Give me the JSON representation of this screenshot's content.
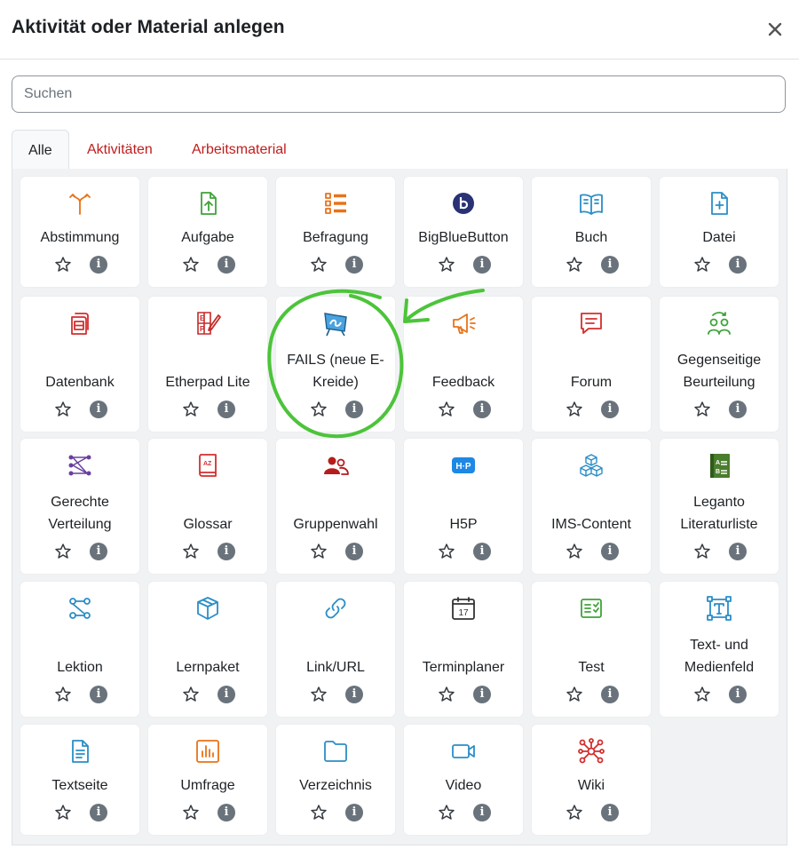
{
  "dialog": {
    "title": "Aktivität oder Material anlegen",
    "close_label": "×"
  },
  "search": {
    "placeholder": "Suchen"
  },
  "tabs": [
    {
      "label": "Alle",
      "active": true
    },
    {
      "label": "Aktivitäten",
      "active": false
    },
    {
      "label": "Arbeitsmaterial",
      "active": false
    }
  ],
  "info_glyph": "i",
  "modules": [
    {
      "name": "Abstimmung",
      "icon": "abstimmung-icon",
      "color": "#e8731a"
    },
    {
      "name": "Aufgabe",
      "icon": "aufgabe-icon",
      "color": "#3fa33a"
    },
    {
      "name": "Befragung",
      "icon": "befragung-icon",
      "color": "#e8731a"
    },
    {
      "name": "BigBlueButton",
      "icon": "bigbluebutton-icon",
      "color": "#283274"
    },
    {
      "name": "Buch",
      "icon": "buch-icon",
      "color": "#2a8ec7"
    },
    {
      "name": "Datei",
      "icon": "datei-icon",
      "color": "#2a8ec7"
    },
    {
      "name": "Datenbank",
      "icon": "datenbank-icon",
      "color": "#d32f2f"
    },
    {
      "name": "Etherpad Lite",
      "icon": "etherpad-icon",
      "color": "#c62828"
    },
    {
      "name": "FAILS (neue E-Kreide)",
      "icon": "fails-icon",
      "color": "#2a8ec7"
    },
    {
      "name": "Feedback",
      "icon": "feedback-icon",
      "color": "#e8731a"
    },
    {
      "name": "Forum",
      "icon": "forum-icon",
      "color": "#d32f2f"
    },
    {
      "name": "Gegenseitige Beurteilung",
      "icon": "gegenseitige-beurteilung-icon",
      "color": "#3fa33a"
    },
    {
      "name": "Gerechte Verteilung",
      "icon": "gerechte-verteilung-icon",
      "color": "#6a3fa0"
    },
    {
      "name": "Glossar",
      "icon": "glossar-icon",
      "color": "#d32f2f"
    },
    {
      "name": "Gruppenwahl",
      "icon": "gruppenwahl-icon",
      "color": "#b71c1c"
    },
    {
      "name": "H5P",
      "icon": "h5p-icon",
      "color": "#1e88e5"
    },
    {
      "name": "IMS-Content",
      "icon": "ims-content-icon",
      "color": "#2a8ec7"
    },
    {
      "name": "Leganto Literaturliste",
      "icon": "leganto-icon",
      "color": "#4a7d2c"
    },
    {
      "name": "Lektion",
      "icon": "lektion-icon",
      "color": "#2a8ec7"
    },
    {
      "name": "Lernpaket",
      "icon": "lernpaket-icon",
      "color": "#2a8ec7"
    },
    {
      "name": "Link/URL",
      "icon": "link-icon",
      "color": "#2a8ec7"
    },
    {
      "name": "Terminplaner",
      "icon": "terminplaner-icon",
      "color": "#333333"
    },
    {
      "name": "Test",
      "icon": "test-icon",
      "color": "#3fa33a"
    },
    {
      "name": "Text- und Medienfeld",
      "icon": "text-medienfeld-icon",
      "color": "#2a8ec7"
    },
    {
      "name": "Textseite",
      "icon": "textseite-icon",
      "color": "#2a8ec7"
    },
    {
      "name": "Umfrage",
      "icon": "umfrage-icon",
      "color": "#e8731a"
    },
    {
      "name": "Verzeichnis",
      "icon": "verzeichnis-icon",
      "color": "#2a8ec7"
    },
    {
      "name": "Video",
      "icon": "video-icon",
      "color": "#2a8ec7"
    },
    {
      "name": "Wiki",
      "icon": "wiki-icon",
      "color": "#d32f2f"
    }
  ],
  "annotation": {
    "color": "#4cc43a"
  },
  "calendar_day": "17",
  "glossar_letters": "AZ",
  "h5p_label": "H·P"
}
